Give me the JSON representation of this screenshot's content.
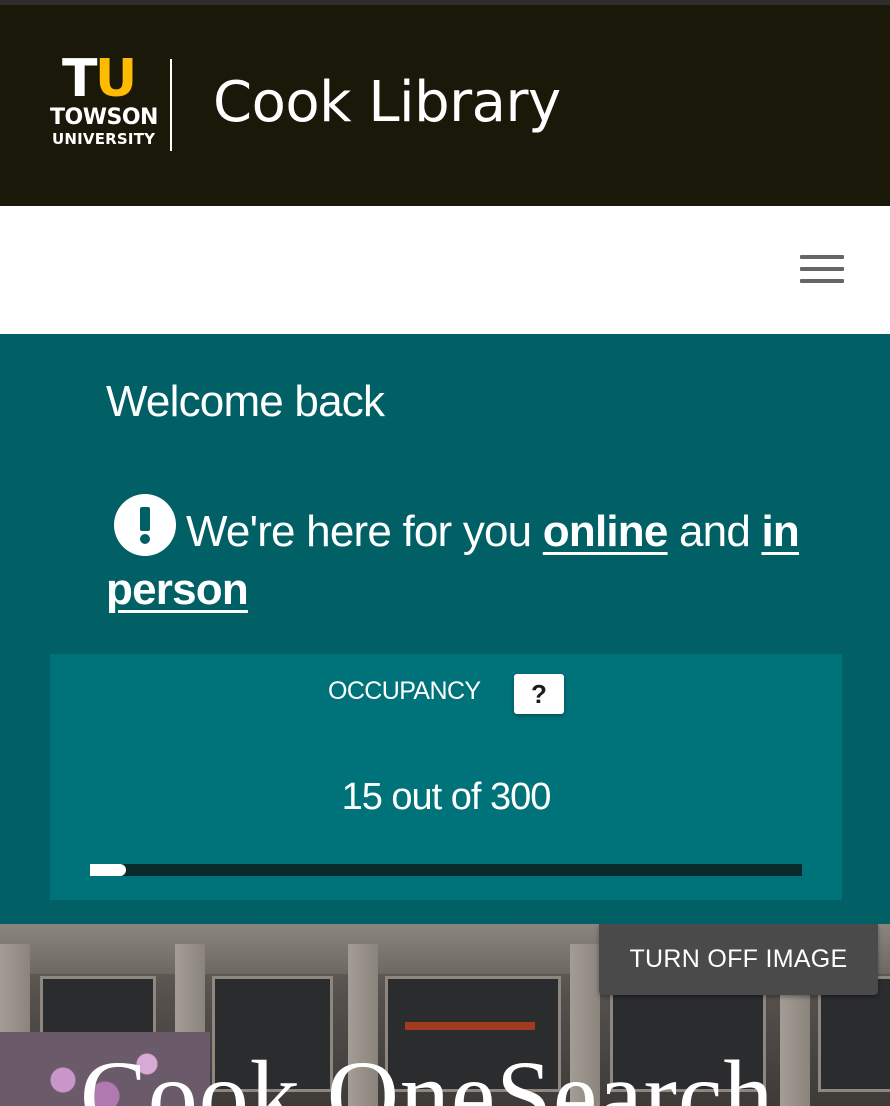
{
  "header": {
    "logo_t": "T",
    "logo_u": "U",
    "logo_line1": "TOWSON",
    "logo_line2": "UNIVERSITY",
    "site_title": "Cook Library"
  },
  "nav": {
    "menu_icon": "hamburger-menu-icon"
  },
  "welcome": {
    "heading": "Welcome back",
    "notice_icon": "exclamation-circle-icon",
    "notice_prefix": "We're here for you",
    "link_online": "online",
    "notice_and": "and",
    "link_in_person": "in person"
  },
  "occupancy": {
    "label": "OCCUPANCY",
    "help_label": "?",
    "count_text": "15 out of 300",
    "current": 15,
    "capacity": 300
  },
  "hero": {
    "toggle_label": "TURN OFF IMAGE",
    "title": "Cook OneSearch"
  },
  "colors": {
    "header_bg": "#1a1808",
    "brand_gold": "#ffbb00",
    "teal": "#006066",
    "teal_panel": "#00737a"
  }
}
